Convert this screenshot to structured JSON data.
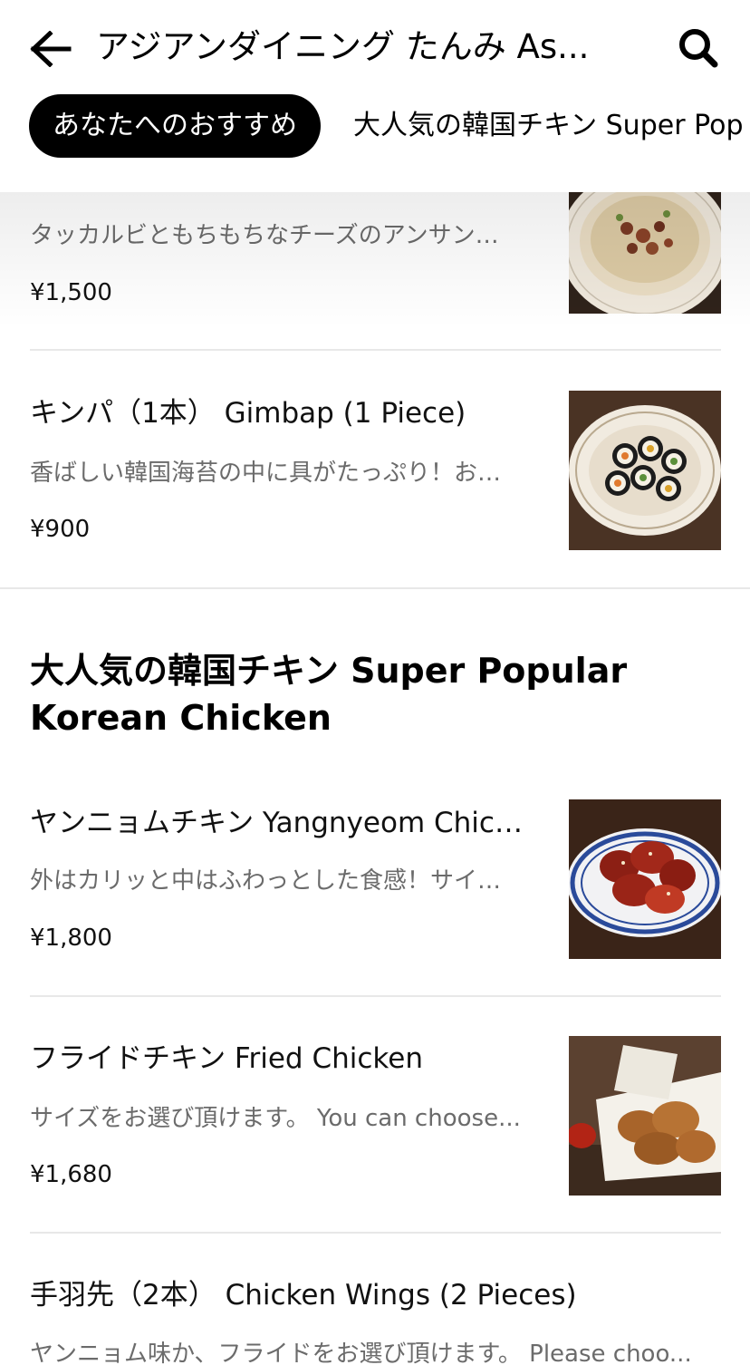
{
  "header": {
    "back_icon": "arrow-left-icon",
    "title": "アジアンダイニング たんみ As...",
    "search_icon": "search-icon"
  },
  "tabs": [
    {
      "label": "あなたへのおすすめ",
      "active": true
    },
    {
      "label": "大人気の韓国チキン Super Pop",
      "active": false
    }
  ],
  "items_top": [
    {
      "name": "",
      "description": "タッカルビともちもちなチーズのアンサン…",
      "price": "¥1,500"
    },
    {
      "name": "キンパ（1本） Gimbap (1 Piece)",
      "description": "香ばしい韓国海苔の中に具がたっぷり！お…",
      "price": "¥900"
    }
  ],
  "section": {
    "title": "大人気の韓国チキン Super Popular Korean Chicken",
    "items": [
      {
        "name": "ヤンニョムチキン Yangnyeom Chick...",
        "description": "外はカリッと中はふわっとした食感！サイ…",
        "price": "¥1,800"
      },
      {
        "name": "フライドチキン Fried Chicken",
        "description": "サイズをお選び頂けます。 You can choose...",
        "price": "¥1,680"
      },
      {
        "name": "手羽先（2本） Chicken Wings (2 Pieces)",
        "description": "ヤンニョム味か、フライドをお選び頂けます。 Please choo..."
      }
    ]
  },
  "colors": {
    "accent": "#000000",
    "text_secondary": "#6b6b6b",
    "divider": "#e8e8e8"
  }
}
